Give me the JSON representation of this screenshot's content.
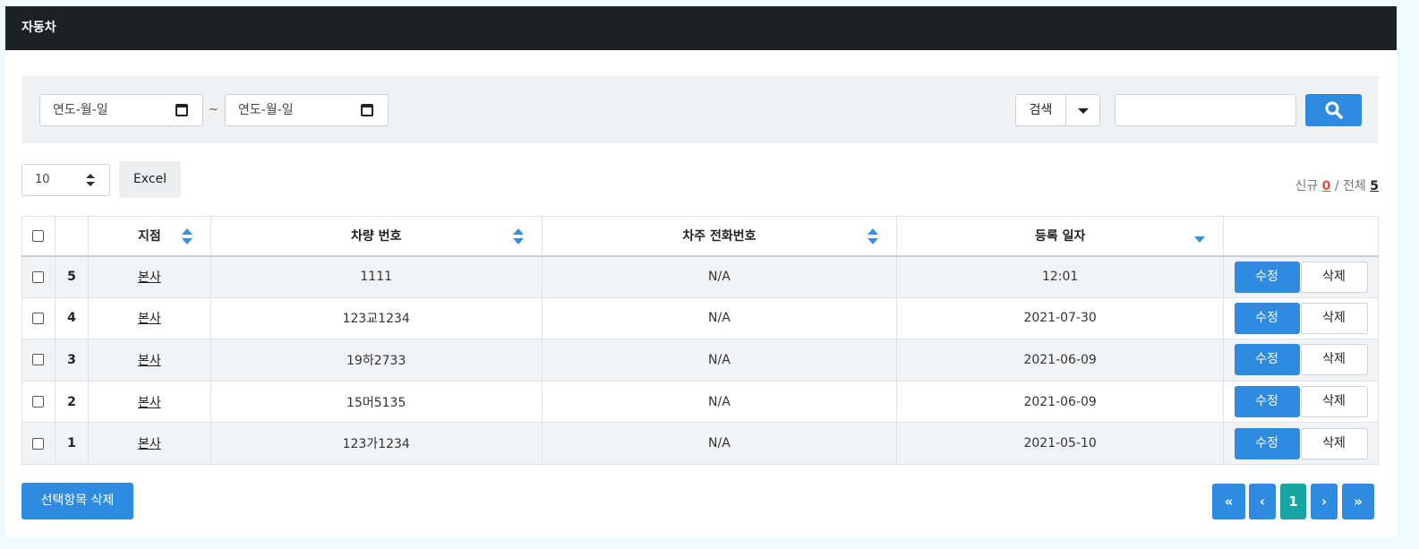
{
  "header": {
    "title": "자동차"
  },
  "filters": {
    "date_from_placeholder": "연도-월-일",
    "date_to_placeholder": "연도-월-일",
    "range_sep": "~",
    "search_type": "검색",
    "search_value": ""
  },
  "toolbar": {
    "page_size": "10",
    "excel_label": "Excel",
    "new_label": "신규",
    "new_count": "0",
    "separator": "/",
    "total_label": "전체",
    "total_count": "5"
  },
  "table": {
    "columns": [
      "",
      "",
      "지점",
      "차량 번호",
      "차주 전화번호",
      "등록 일자",
      ""
    ],
    "rows": [
      {
        "no": "5",
        "branch": "본사",
        "plate": "1111",
        "phone": "N/A",
        "date": "12:01",
        "edit": "수정",
        "delete": "삭제"
      },
      {
        "no": "4",
        "branch": "본사",
        "plate": "123교1234",
        "phone": "N/A",
        "date": "2021-07-30",
        "edit": "수정",
        "delete": "삭제"
      },
      {
        "no": "3",
        "branch": "본사",
        "plate": "19하2733",
        "phone": "N/A",
        "date": "2021-06-09",
        "edit": "수정",
        "delete": "삭제"
      },
      {
        "no": "2",
        "branch": "본사",
        "plate": "15머5135",
        "phone": "N/A",
        "date": "2021-06-09",
        "edit": "수정",
        "delete": "삭제"
      },
      {
        "no": "1",
        "branch": "본사",
        "plate": "123가1234",
        "phone": "N/A",
        "date": "2021-05-10",
        "edit": "수정",
        "delete": "삭제"
      }
    ]
  },
  "footer": {
    "bulk_delete_label": "선택항목 삭제",
    "pagination": {
      "first": "«",
      "prev": "‹",
      "current": "1",
      "next": "›",
      "last": "»"
    }
  },
  "colors": {
    "header_bg": "#1c2127",
    "primary": "#2e8bdf",
    "active_page": "#16a5a0",
    "new_count": "#e84a3c"
  },
  "icons": [
    "calendar-icon",
    "caret-down-icon",
    "search-icon",
    "sort-icon",
    "sort-desc-icon"
  ]
}
